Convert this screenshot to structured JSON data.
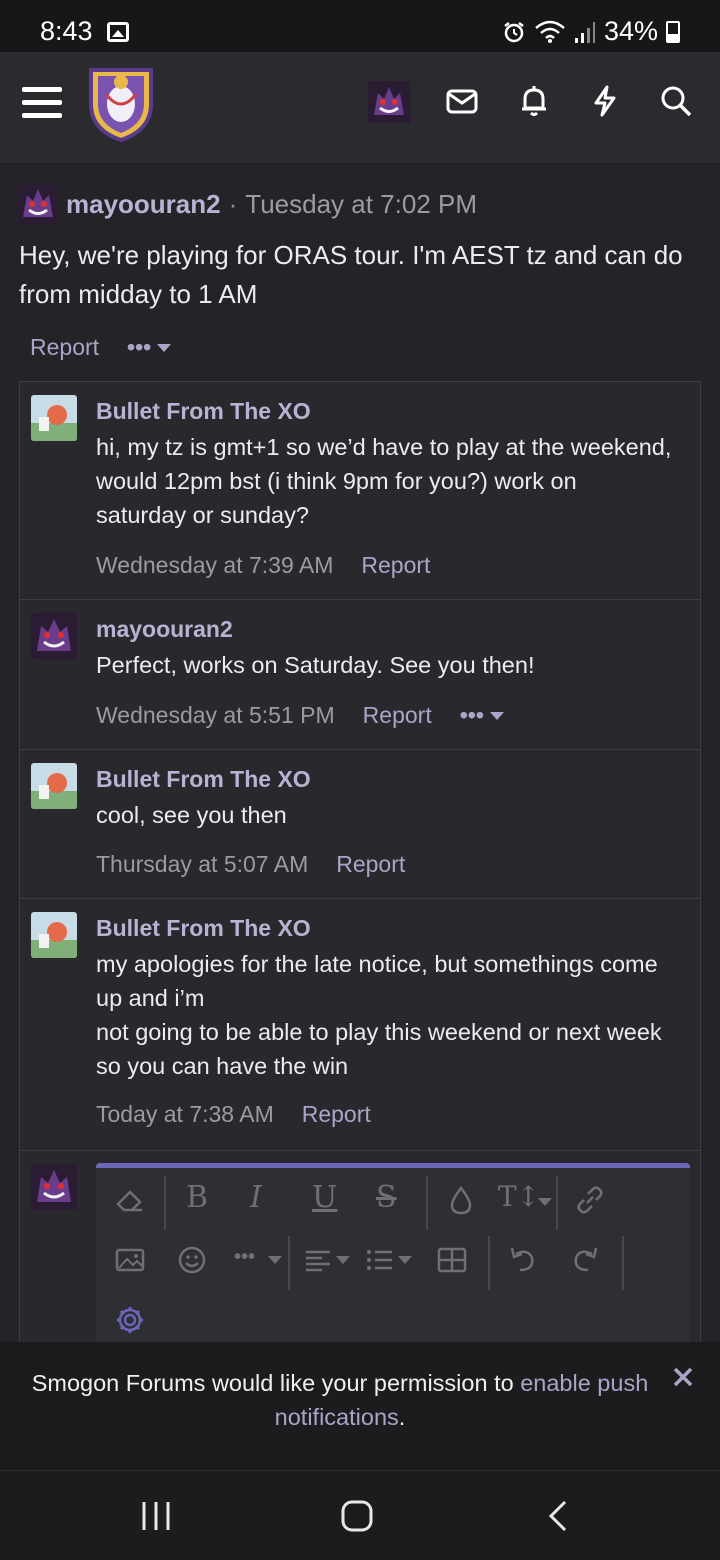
{
  "status_bar": {
    "time": "8:43",
    "battery": "34%"
  },
  "header": {
    "icons": [
      "menu-icon",
      "site-logo",
      "user-avatar",
      "inbox-icon",
      "bell-icon",
      "bolt-icon",
      "search-icon"
    ]
  },
  "post": {
    "author": "mayoouran2",
    "separator": "·",
    "date": "Tuesday at 7:02 PM",
    "body": "Hey, we're playing for ORAS tour. I'm AEST tz and can do from midday to 1 AM",
    "report_label": "Report",
    "more_label": "•••"
  },
  "comments": [
    {
      "author": "Bullet From The XO",
      "body_lines": [
        "hi, my tz is gmt+1 so we’d have to play at the weekend,",
        "would 12pm bst (i think 9pm for you?) work on",
        "saturday or sunday?"
      ],
      "date": "Wednesday at 7:39 AM",
      "report": "Report"
    },
    {
      "author": "mayoouran2",
      "body_lines": [
        "Perfect, works on Saturday. See you then!"
      ],
      "date": "Wednesday at 5:51 PM",
      "report": "Report",
      "more": "•••"
    },
    {
      "author": "Bullet From The XO",
      "body_lines": [
        "cool, see you then"
      ],
      "date": "Thursday at 5:07 AM",
      "report": "Report"
    },
    {
      "author": "Bullet From The XO",
      "body_lines": [
        "my apologies for the late notice, but somethings come",
        "up and i’m",
        "not going to be able to play this weekend or next week",
        "so you can have the win"
      ],
      "date": "Today at 7:38 AM",
      "report": "Report"
    }
  ],
  "editor": {
    "toolbar": {
      "bold": "B",
      "italic": "I",
      "underline": "U",
      "strike": "S",
      "text_size": "T↕",
      "more": "•••"
    }
  },
  "push_banner": {
    "text": "Smogon Forums would like your permission to ",
    "link": "enable push notifications",
    "end": "."
  },
  "colors": {
    "accent": "#a9a5c7",
    "author": "#b7b4d3",
    "editor_border": "#6b67b8"
  }
}
